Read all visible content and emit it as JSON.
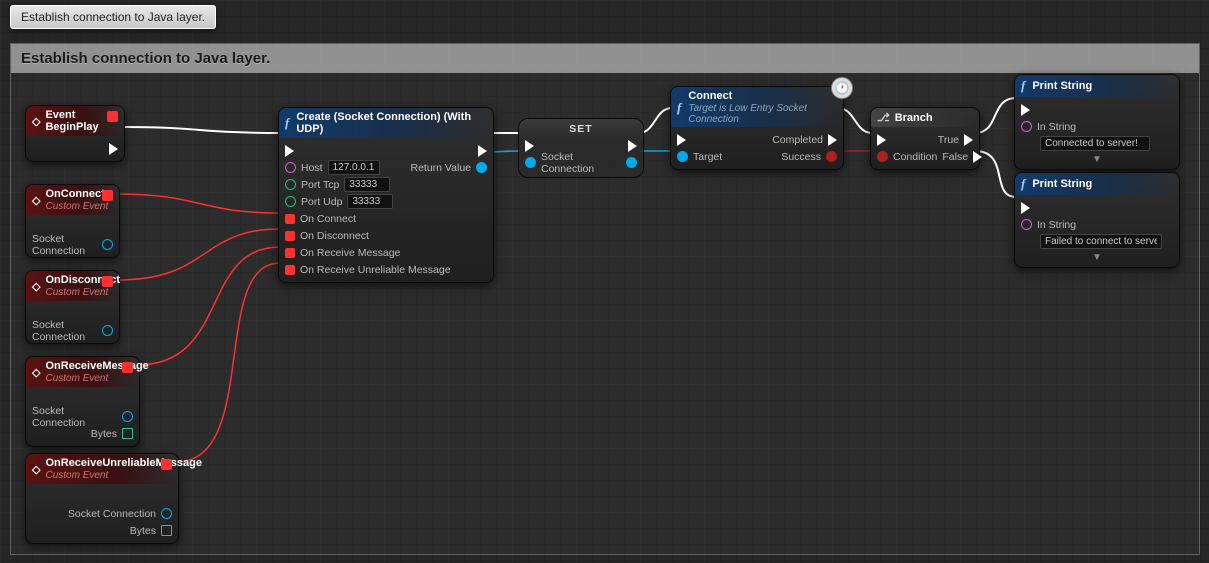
{
  "tooltip": "Establish connection to Java layer.",
  "comment": "Establish connection to Java layer.",
  "nodes": {
    "beginplay": {
      "title": "Event BeginPlay"
    },
    "onconnect": {
      "title": "OnConnect",
      "sub": "Custom Event",
      "out": "Socket Connection"
    },
    "ondisconnect": {
      "title": "OnDisconnect",
      "sub": "Custom Event",
      "out": "Socket Connection"
    },
    "onreceive": {
      "title": "OnReceiveMessage",
      "sub": "Custom Event",
      "out1": "Socket Connection",
      "out2": "Bytes"
    },
    "onreceiveunrel": {
      "title": "OnReceiveUnreliableMessage",
      "sub": "Custom Event",
      "out1": "Socket Connection",
      "out2": "Bytes"
    },
    "create": {
      "title": "Create (Socket Connection) (With UDP)",
      "pins": {
        "host_label": "Host",
        "host_val": "127.0.0.1",
        "tcp_label": "Port Tcp",
        "tcp_val": "33333",
        "udp_label": "Port Udp",
        "udp_val": "33333",
        "onconnect": "On Connect",
        "ondisconnect": "On Disconnect",
        "onreceive": "On Receive Message",
        "onreceiveunrel": "On Receive Unreliable Message",
        "retval": "Return Value"
      }
    },
    "set": {
      "title": "SET",
      "pin": "Socket Connection"
    },
    "connect": {
      "title": "Connect",
      "sub": "Target is Low Entry Socket Connection",
      "target": "Target",
      "completed": "Completed",
      "success": "Success"
    },
    "branch": {
      "title": "Branch",
      "cond": "Condition",
      "t": "True",
      "f": "False"
    },
    "print1": {
      "title": "Print String",
      "instr": "In String",
      "val": "Connected to server!"
    },
    "print2": {
      "title": "Print String",
      "instr": "In String",
      "val": "Failed to connect to server."
    }
  }
}
